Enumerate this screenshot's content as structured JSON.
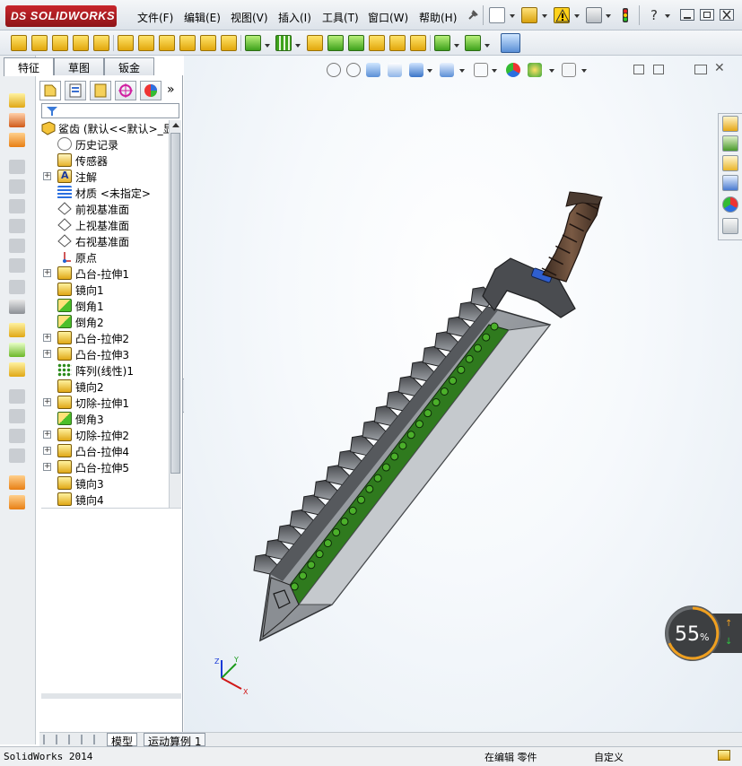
{
  "app": {
    "logo_brand": "SOLIDWORKS",
    "logo_mark": "DS"
  },
  "menu": [
    {
      "label": "文件(F)"
    },
    {
      "label": "编辑(E)"
    },
    {
      "label": "视图(V)"
    },
    {
      "label": "插入(I)"
    },
    {
      "label": "工具(T)"
    },
    {
      "label": "窗口(W)"
    },
    {
      "label": "帮助(H)"
    }
  ],
  "command_tabs": [
    {
      "label": "特征",
      "active": true
    },
    {
      "label": "草图",
      "active": false
    },
    {
      "label": "钣金",
      "active": false
    }
  ],
  "feature_tree": {
    "root": "鲨齿  (默认<<默认>_显",
    "items": [
      {
        "label": "历史记录",
        "icon": "history-icon",
        "expandable": false
      },
      {
        "label": "传感器",
        "icon": "sensor-icon",
        "expandable": false
      },
      {
        "label": "注解",
        "icon": "annotation-icon",
        "expandable": true
      },
      {
        "label": "材质 <未指定>",
        "icon": "material-icon",
        "expandable": false
      },
      {
        "label": "前视基准面",
        "icon": "plane-icon",
        "expandable": false
      },
      {
        "label": "上视基准面",
        "icon": "plane-icon",
        "expandable": false
      },
      {
        "label": "右视基准面",
        "icon": "plane-icon",
        "expandable": false
      },
      {
        "label": "原点",
        "icon": "origin-icon",
        "expandable": false
      },
      {
        "label": "凸台-拉伸1",
        "icon": "boss-extrude-icon",
        "expandable": true
      },
      {
        "label": "镜向1",
        "icon": "mirror-icon",
        "expandable": false
      },
      {
        "label": "倒角1",
        "icon": "chamfer-icon",
        "expandable": false
      },
      {
        "label": "倒角2",
        "icon": "chamfer-icon",
        "expandable": false
      },
      {
        "label": "凸台-拉伸2",
        "icon": "boss-extrude-icon",
        "expandable": true
      },
      {
        "label": "凸台-拉伸3",
        "icon": "boss-extrude-icon",
        "expandable": true
      },
      {
        "label": "阵列(线性)1",
        "icon": "linear-pattern-icon",
        "expandable": false
      },
      {
        "label": "镜向2",
        "icon": "mirror-icon",
        "expandable": false
      },
      {
        "label": "切除-拉伸1",
        "icon": "cut-extrude-icon",
        "expandable": true
      },
      {
        "label": "倒角3",
        "icon": "chamfer-icon",
        "expandable": false
      },
      {
        "label": "切除-拉伸2",
        "icon": "cut-extrude-icon",
        "expandable": true
      },
      {
        "label": "凸台-拉伸4",
        "icon": "boss-extrude-icon",
        "expandable": true
      },
      {
        "label": "凸台-拉伸5",
        "icon": "boss-extrude-icon",
        "expandable": true
      },
      {
        "label": "镜向3",
        "icon": "mirror-icon",
        "expandable": false
      },
      {
        "label": "镜向4",
        "icon": "mirror-icon",
        "expandable": false
      }
    ]
  },
  "bottom_tabs": [
    {
      "label": "模型",
      "active": true
    },
    {
      "label": "运动算例 1",
      "active": false
    }
  ],
  "status": {
    "app_version": "SolidWorks 2014",
    "editing": "在编辑 零件",
    "custom": "自定义"
  },
  "zoom_overlay": {
    "value": "55",
    "unit": "%"
  },
  "triad": {
    "x": "X",
    "y": "Y",
    "z": "Z"
  },
  "colors": {
    "blade_steel": "#8d9196",
    "blade_dark": "#3b3d40",
    "inlay_green": "#2f7a1e",
    "handle_brown": "#5a4030",
    "gem_blue": "#2f5fd0",
    "brand_red": "#c8262c"
  }
}
